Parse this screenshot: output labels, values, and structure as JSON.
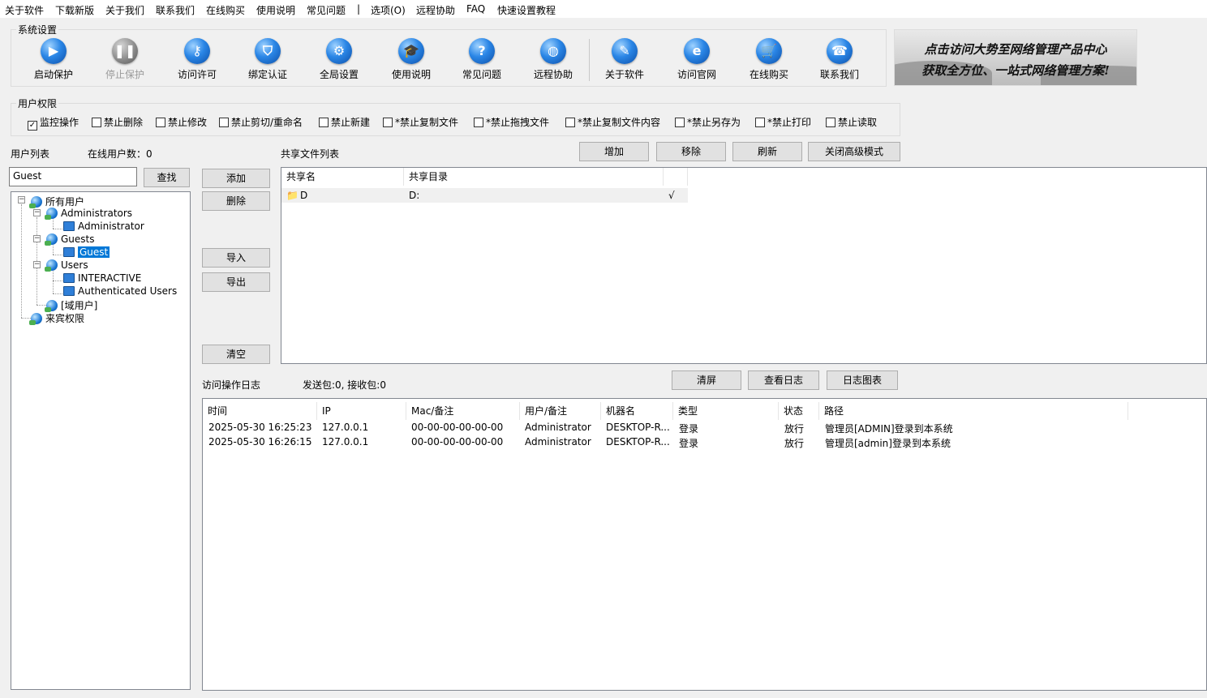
{
  "menu": [
    "关于软件",
    "下载新版",
    "关于我们",
    "联系我们",
    "在线购买",
    "使用说明",
    "常见问题",
    "|",
    "选项(O)",
    "远程协助",
    "FAQ",
    "快速设置教程"
  ],
  "system_settings": {
    "legend": "系统设置",
    "tools": [
      {
        "label": "启动保护",
        "icon": "play-icon"
      },
      {
        "label": "停止保护",
        "icon": "pause-icon",
        "disabled": true
      },
      {
        "label": "访问许可",
        "icon": "key-icon"
      },
      {
        "label": "绑定认证",
        "icon": "shield-icon"
      },
      {
        "label": "全局设置",
        "icon": "gear-icon"
      },
      {
        "label": "使用说明",
        "icon": "graduation-cap-icon"
      },
      {
        "label": "常见问题",
        "icon": "question-icon"
      },
      {
        "label": "远程协助",
        "icon": "remote-globe-icon"
      },
      {
        "label": "关于软件",
        "icon": "document-pen-icon"
      },
      {
        "label": "访问官网",
        "icon": "browser-e-icon"
      },
      {
        "label": "在线购买",
        "icon": "cart-icon"
      },
      {
        "label": "联系我们",
        "icon": "phone-icon"
      }
    ]
  },
  "banner": {
    "line1": "点击访问大势至网络管理产品中心",
    "line2": "获取全方位、一站式网络管理方案!"
  },
  "permissions": {
    "legend": "用户权限",
    "items": [
      {
        "label": "监控操作",
        "checked": true
      },
      {
        "label": "禁止删除",
        "checked": false
      },
      {
        "label": "禁止修改",
        "checked": false
      },
      {
        "label": "禁止剪切/重命名",
        "checked": false
      },
      {
        "label": "禁止新建",
        "checked": false
      },
      {
        "label": "*禁止复制文件",
        "checked": false
      },
      {
        "label": "*禁止拖拽文件",
        "checked": false
      },
      {
        "label": "*禁止复制文件内容",
        "checked": false
      },
      {
        "label": "*禁止另存为",
        "checked": false
      },
      {
        "label": "*禁止打印",
        "checked": false
      },
      {
        "label": "禁止读取",
        "checked": false
      }
    ]
  },
  "users": {
    "title": "用户列表",
    "online_label": "在线用户数：",
    "online_count": "0",
    "search_value": "Guest",
    "search_button": "查找",
    "tree": {
      "root": "所有用户",
      "administrators": "Administrators",
      "administrator": "Administrator",
      "guests": "Guests",
      "guest": "Guest",
      "users": "Users",
      "interactive": "INTERACTIVE",
      "authenticated": "Authenticated Users",
      "domain_users": "[域用户]",
      "guest_rights": "来宾权限"
    }
  },
  "mid_buttons": {
    "add": "添加",
    "delete": "删除",
    "import": "导入",
    "export": "导出",
    "clear": "清空"
  },
  "shares": {
    "title": "共享文件列表",
    "buttons": {
      "add": "增加",
      "remove": "移除",
      "refresh": "刷新",
      "close_adv": "关闭高级模式"
    },
    "columns": [
      "共享名",
      "共享目录"
    ],
    "rows": [
      {
        "name": "D",
        "dir": "D:",
        "check": "√"
      }
    ]
  },
  "log": {
    "title": "访问操作日志",
    "packets": "发送包:0, 接收包:0",
    "buttons": {
      "clear": "清屏",
      "view": "查看日志",
      "chart": "日志图表"
    },
    "columns": [
      "时间",
      "IP",
      "Mac/备注",
      "用户/备注",
      "机器名",
      "类型",
      "状态",
      "路径"
    ],
    "rows": [
      {
        "time": "2025-05-30 16:25:23",
        "ip": "127.0.0.1",
        "mac": "00-00-00-00-00-00",
        "user": "Administrator",
        "machine": "DESKTOP-R...",
        "type": "登录",
        "status": "放行",
        "path": "管理员[ADMIN]登录到本系统"
      },
      {
        "time": "2025-05-30 16:26:15",
        "ip": "127.0.0.1",
        "mac": "00-00-00-00-00-00",
        "user": "Administrator",
        "machine": "DESKTOP-R...",
        "type": "登录",
        "status": "放行",
        "path": "管理员[admin]登录到本系统"
      }
    ]
  }
}
